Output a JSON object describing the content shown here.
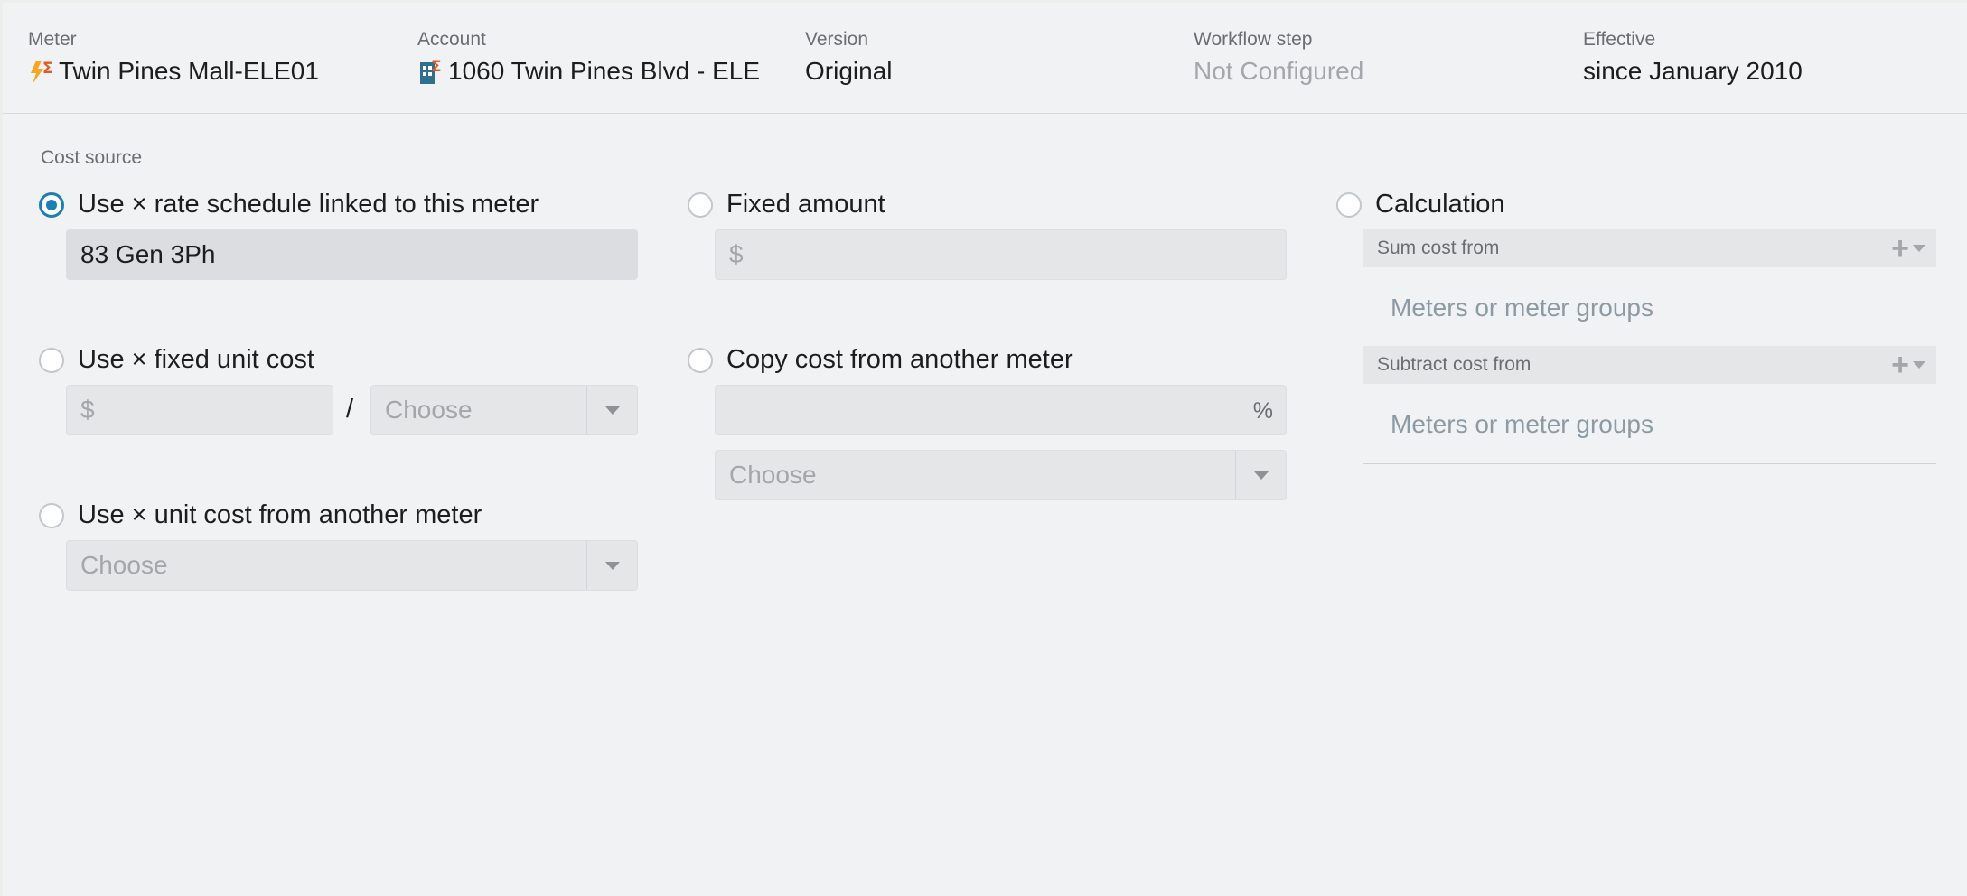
{
  "header": {
    "meter": {
      "label": "Meter",
      "value": "Twin Pines Mall-ELE01",
      "icon": "electric-meter-icon"
    },
    "account": {
      "label": "Account",
      "value": "1060 Twin Pines Blvd - ELE",
      "icon": "building-account-icon"
    },
    "version": {
      "label": "Version",
      "value": "Original"
    },
    "workflow": {
      "label": "Workflow step",
      "value": "Not Configured"
    },
    "effective": {
      "label": "Effective",
      "value": "since January 2010"
    }
  },
  "cost_source": {
    "label": "Cost source",
    "rate_schedule": {
      "label": "Use × rate schedule linked to this meter",
      "value": "83 Gen 3Ph",
      "selected": true
    },
    "fixed_unit_cost": {
      "label": "Use × fixed unit cost",
      "amount_placeholder": "$",
      "separator": "/",
      "unit_placeholder": "Choose",
      "selected": false
    },
    "unit_cost_other": {
      "label": "Use × unit cost from another meter",
      "meter_placeholder": "Choose",
      "selected": false
    },
    "fixed_amount": {
      "label": "Fixed amount",
      "amount_placeholder": "$",
      "selected": false
    },
    "copy_cost": {
      "label": "Copy cost from another meter",
      "percent_suffix": "%",
      "meter_placeholder": "Choose",
      "selected": false
    },
    "calculation": {
      "label": "Calculation",
      "selected": false,
      "sum": {
        "label": "Sum cost from",
        "placeholder": "Meters or meter groups"
      },
      "subtract": {
        "label": "Subtract cost from",
        "placeholder": "Meters or meter groups"
      }
    }
  },
  "colors": {
    "accent": "#1e7fb4",
    "placeholder": "#8b9ba5",
    "background": "#f1f2f4"
  }
}
